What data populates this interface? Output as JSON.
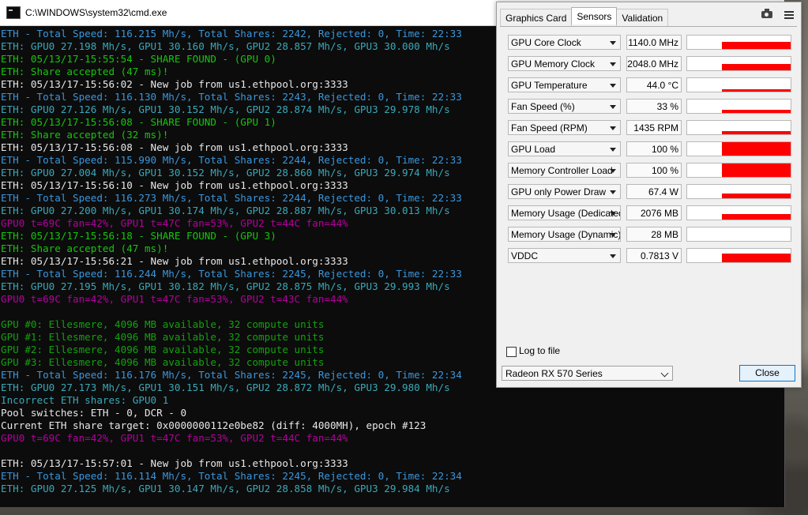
{
  "cmd": {
    "title": "C:\\WINDOWS\\system32\\cmd.exe",
    "lines": [
      {
        "text": "ETH - Total Speed: 116.215 Mh/s, Total Shares: 2242, Rejected: 0, Time: 22:33",
        "color": "cyan"
      },
      {
        "text": "ETH: GPU0 27.198 Mh/s, GPU1 30.160 Mh/s, GPU2 28.857 Mh/s, GPU3 30.000 Mh/s",
        "color": "teal"
      },
      {
        "text": "ETH: 05/13/17-15:55:54 - SHARE FOUND - (GPU 0)",
        "color": "lgreen"
      },
      {
        "text": "ETH: Share accepted (47 ms)!",
        "color": "lgreen"
      },
      {
        "text": "ETH: 05/13/17-15:56:02 - New job from us1.ethpool.org:3333",
        "color": "white"
      },
      {
        "text": "ETH - Total Speed: 116.130 Mh/s, Total Shares: 2243, Rejected: 0, Time: 22:33",
        "color": "cyan"
      },
      {
        "text": "ETH: GPU0 27.126 Mh/s, GPU1 30.152 Mh/s, GPU2 28.874 Mh/s, GPU3 29.978 Mh/s",
        "color": "teal"
      },
      {
        "text": "ETH: 05/13/17-15:56:08 - SHARE FOUND - (GPU 1)",
        "color": "lgreen"
      },
      {
        "text": "ETH: Share accepted (32 ms)!",
        "color": "lgreen"
      },
      {
        "text": "ETH: 05/13/17-15:56:08 - New job from us1.ethpool.org:3333",
        "color": "white"
      },
      {
        "text": "ETH - Total Speed: 115.990 Mh/s, Total Shares: 2244, Rejected: 0, Time: 22:33",
        "color": "cyan"
      },
      {
        "text": "ETH: GPU0 27.004 Mh/s, GPU1 30.152 Mh/s, GPU2 28.860 Mh/s, GPU3 29.974 Mh/s",
        "color": "teal"
      },
      {
        "text": "ETH: 05/13/17-15:56:10 - New job from us1.ethpool.org:3333",
        "color": "white"
      },
      {
        "text": "ETH - Total Speed: 116.273 Mh/s, Total Shares: 2244, Rejected: 0, Time: 22:33",
        "color": "cyan"
      },
      {
        "text": "ETH: GPU0 27.200 Mh/s, GPU1 30.174 Mh/s, GPU2 28.887 Mh/s, GPU3 30.013 Mh/s",
        "color": "teal"
      },
      {
        "text": "GPU0 t=69C fan=42%, GPU1 t=47C fan=53%, GPU2 t=44C fan=44%",
        "color": "magenta"
      },
      {
        "text": "ETH: 05/13/17-15:56:18 - SHARE FOUND - (GPU 3)",
        "color": "lgreen"
      },
      {
        "text": "ETH: Share accepted (47 ms)!",
        "color": "lgreen"
      },
      {
        "text": "ETH: 05/13/17-15:56:21 - New job from us1.ethpool.org:3333",
        "color": "white"
      },
      {
        "text": "ETH - Total Speed: 116.244 Mh/s, Total Shares: 2245, Rejected: 0, Time: 22:33",
        "color": "cyan"
      },
      {
        "text": "ETH: GPU0 27.195 Mh/s, GPU1 30.182 Mh/s, GPU2 28.875 Mh/s, GPU3 29.993 Mh/s",
        "color": "teal"
      },
      {
        "text": "GPU0 t=69C fan=42%, GPU1 t=47C fan=53%, GPU2 t=43C fan=44%",
        "color": "magenta"
      },
      {
        "text": "",
        "color": "white"
      },
      {
        "text": "GPU #0: Ellesmere, 4096 MB available, 32 compute units",
        "color": "green"
      },
      {
        "text": "GPU #1: Ellesmere, 4096 MB available, 32 compute units",
        "color": "green"
      },
      {
        "text": "GPU #2: Ellesmere, 4096 MB available, 32 compute units",
        "color": "green"
      },
      {
        "text": "GPU #3: Ellesmere, 4096 MB available, 32 compute units",
        "color": "green"
      },
      {
        "text": "ETH - Total Speed: 116.176 Mh/s, Total Shares: 2245, Rejected: 0, Time: 22:34",
        "color": "cyan"
      },
      {
        "text": "ETH: GPU0 27.173 Mh/s, GPU1 30.151 Mh/s, GPU2 28.872 Mh/s, GPU3 29.980 Mh/s",
        "color": "teal"
      },
      {
        "text": "Incorrect ETH shares: GPU0 1",
        "color": "teal"
      },
      {
        "text": "Pool switches: ETH - 0, DCR - 0",
        "color": "white"
      },
      {
        "text": "Current ETH share target: 0x0000000112e0be82 (diff: 4000MH), epoch #123",
        "color": "white"
      },
      {
        "text": "GPU0 t=69C fan=42%, GPU1 t=47C fan=53%, GPU2 t=44C fan=44%",
        "color": "magenta"
      },
      {
        "text": "",
        "color": "white"
      },
      {
        "text": "ETH: 05/13/17-15:57:01 - New job from us1.ethpool.org:3333",
        "color": "white"
      },
      {
        "text": "ETH - Total Speed: 116.114 Mh/s, Total Shares: 2245, Rejected: 0, Time: 22:34",
        "color": "cyan"
      },
      {
        "text": "ETH: GPU0 27.125 Mh/s, GPU1 30.147 Mh/s, GPU2 28.858 Mh/s, GPU3 29.984 Mh/s",
        "color": "teal"
      }
    ]
  },
  "gpuz": {
    "tabs": [
      "Graphics Card",
      "Sensors",
      "Validation"
    ],
    "active_tab": "Sensors",
    "sensors": [
      {
        "label": "GPU Core Clock",
        "value": "1140.0 MHz",
        "level": 0.55
      },
      {
        "label": "GPU Memory Clock",
        "value": "2048.0 MHz",
        "level": 0.45
      },
      {
        "label": "GPU Temperature",
        "value": "44.0 °C",
        "level": 0.2
      },
      {
        "label": "Fan Speed (%)",
        "value": "33 %",
        "level": 0.25
      },
      {
        "label": "Fan Speed (RPM)",
        "value": "1435 RPM",
        "level": 0.25
      },
      {
        "label": "GPU Load",
        "value": "100 %",
        "level": 1.0
      },
      {
        "label": "Memory Controller Load",
        "value": "100 %",
        "level": 1.0
      },
      {
        "label": "GPU only Power Draw",
        "value": "67.4 W",
        "level": 0.35
      },
      {
        "label": "Memory Usage (Dedicated)",
        "value": "2076 MB",
        "level": 0.4
      },
      {
        "label": "Memory Usage (Dynamic)",
        "value": "28 MB",
        "level": 0
      },
      {
        "label": "VDDC",
        "value": "0.7813 V",
        "level": 0.65
      }
    ],
    "log_label": "Log to file",
    "gpu_selected": "Radeon RX 570 Series",
    "close_label": "Close",
    "bar_color": "#ff0000"
  }
}
